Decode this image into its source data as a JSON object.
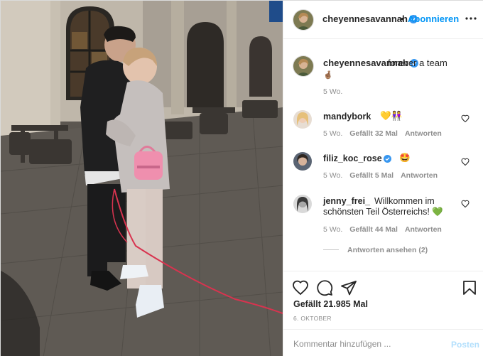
{
  "post": {
    "author": "cheyennesavannah",
    "verified": true,
    "dot": "•",
    "follow_label": "Abonnieren",
    "more_icon": "more-horizontal-icon"
  },
  "caption": {
    "user": "cheyennesavannah",
    "text": "forever a team",
    "emoji": "🤞🏽",
    "time": "5 Wo."
  },
  "comments": [
    {
      "user": "mandybork",
      "verified": false,
      "text": "💛👭",
      "time": "5 Wo.",
      "likes": "Gefällt 32 Mal",
      "reply": "Antworten"
    },
    {
      "user": "filiz_koc_rose",
      "verified": true,
      "text": "🤩",
      "time": "5 Wo.",
      "likes": "Gefällt 5 Mal",
      "reply": "Antworten"
    },
    {
      "user": "jenny_frei_",
      "verified": false,
      "text_line1": "Willkommen im",
      "text_line2": "schönsten Teil Österreichs! 💚",
      "time": "5 Wo.",
      "likes": "Gefällt 44 Mal",
      "reply": "Antworten"
    }
  ],
  "view_replies": "Antworten ansehen (2)",
  "actions": {
    "like_icon": "heart-icon",
    "comment_icon": "comment-icon",
    "share_icon": "share-icon",
    "save_icon": "bookmark-icon"
  },
  "likes_count": "Gefällt 21.985 Mal",
  "date": "6. OKTOBER",
  "add_comment": {
    "placeholder": "Kommentar hinzufügen ...",
    "post_label": "Posten"
  },
  "colors": {
    "link": "#0095f6",
    "muted": "#8e8e8e",
    "verified": "#3897f0",
    "text": "#262626",
    "post_disabled": "#b2dffc"
  }
}
